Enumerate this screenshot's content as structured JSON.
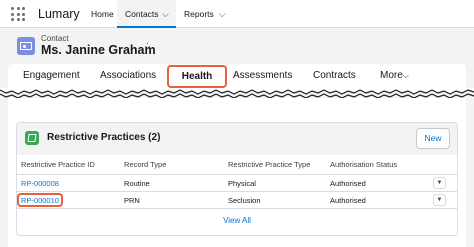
{
  "app": {
    "name": "Lumary"
  },
  "nav": {
    "home": "Home",
    "contacts": "Contacts",
    "reports": "Reports"
  },
  "record": {
    "type": "Contact",
    "name": "Ms. Janine Graham"
  },
  "tabs": {
    "engagement": "Engagement",
    "associations": "Associations",
    "health": "Health",
    "assessments": "Assessments",
    "contracts": "Contracts",
    "more": "More"
  },
  "restrictive": {
    "title": "Restrictive Practices (2)",
    "new_label": "New",
    "columns": [
      "Restrictive Practice ID",
      "Record Type",
      "Restrictive Practice Type",
      "Authorisation Status"
    ],
    "rows": [
      {
        "id": "RP-000008",
        "record_type": "Routine",
        "practice_type": "Physical",
        "status": "Authorised"
      },
      {
        "id": "RP-000010",
        "record_type": "PRN",
        "practice_type": "Seclusion",
        "status": "Authorised"
      }
    ],
    "view_all": "View All"
  },
  "colors": {
    "accent": "#0176d3",
    "highlight": "#e8603c",
    "contact_icon": "#7f8de1",
    "rp_icon": "#3ba755"
  }
}
